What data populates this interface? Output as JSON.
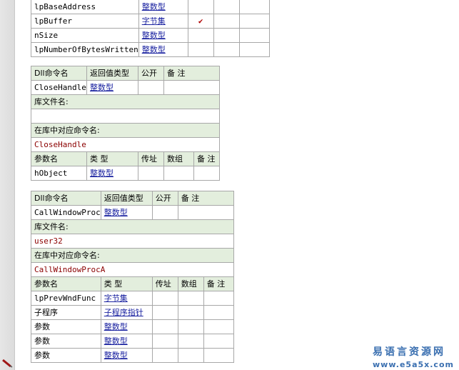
{
  "colors": {
    "header_bg": "#e3eedd",
    "type_link": "#1a22a0",
    "lib_text": "#8b0000",
    "grid_border": "#a8a8a8",
    "watermark": "#3a6fb0"
  },
  "t0": {
    "rows": [
      {
        "name": "lpBaseAddress",
        "type": "整数型",
        "check": ""
      },
      {
        "name": "lpBuffer",
        "type": "字节集",
        "check": "✔"
      },
      {
        "name": "nSize",
        "type": "整数型",
        "check": ""
      },
      {
        "name": "lpNumberOfBytesWritten",
        "type": "整数型",
        "check": ""
      }
    ]
  },
  "t1": {
    "hdr": {
      "dll": "Dll命令名",
      "ret": "返回值类型",
      "pub": "公开",
      "note": "备 注"
    },
    "cmd": {
      "name": "CloseHandle",
      "ret": "整数型"
    },
    "lib_label": "库文件名:",
    "lib_value": "",
    "entry_label": "在库中对应命令名:",
    "entry_value": "CloseHandle",
    "phdr": {
      "name": "参数名",
      "type": "类 型",
      "ref": "传址",
      "arr": "数组",
      "note": "备 注"
    },
    "params": [
      {
        "name": "hObject",
        "type": "整数型"
      }
    ]
  },
  "t2": {
    "hdr": {
      "dll": "Dll命令名",
      "ret": "返回值类型",
      "pub": "公开",
      "note": "备 注"
    },
    "cmd": {
      "name": "CallWindowProc",
      "ret": "整数型"
    },
    "lib_label": "库文件名:",
    "lib_value": "user32",
    "entry_label": "在库中对应命令名:",
    "entry_value": "CallWindowProcA",
    "phdr": {
      "name": "参数名",
      "type": "类 型",
      "ref": "传址",
      "arr": "数组",
      "note": "备 注"
    },
    "params": [
      {
        "name": "lpPrevWndFunc",
        "type": "字节集"
      },
      {
        "name": "子程序",
        "type": "子程序指针"
      },
      {
        "name": "参数",
        "type": "整数型"
      },
      {
        "name": "参数",
        "type": "整数型"
      },
      {
        "name": "参数",
        "type": "整数型"
      }
    ]
  },
  "watermark": {
    "line1": "易语言资源网",
    "line2": "www.e5a5x.com"
  }
}
